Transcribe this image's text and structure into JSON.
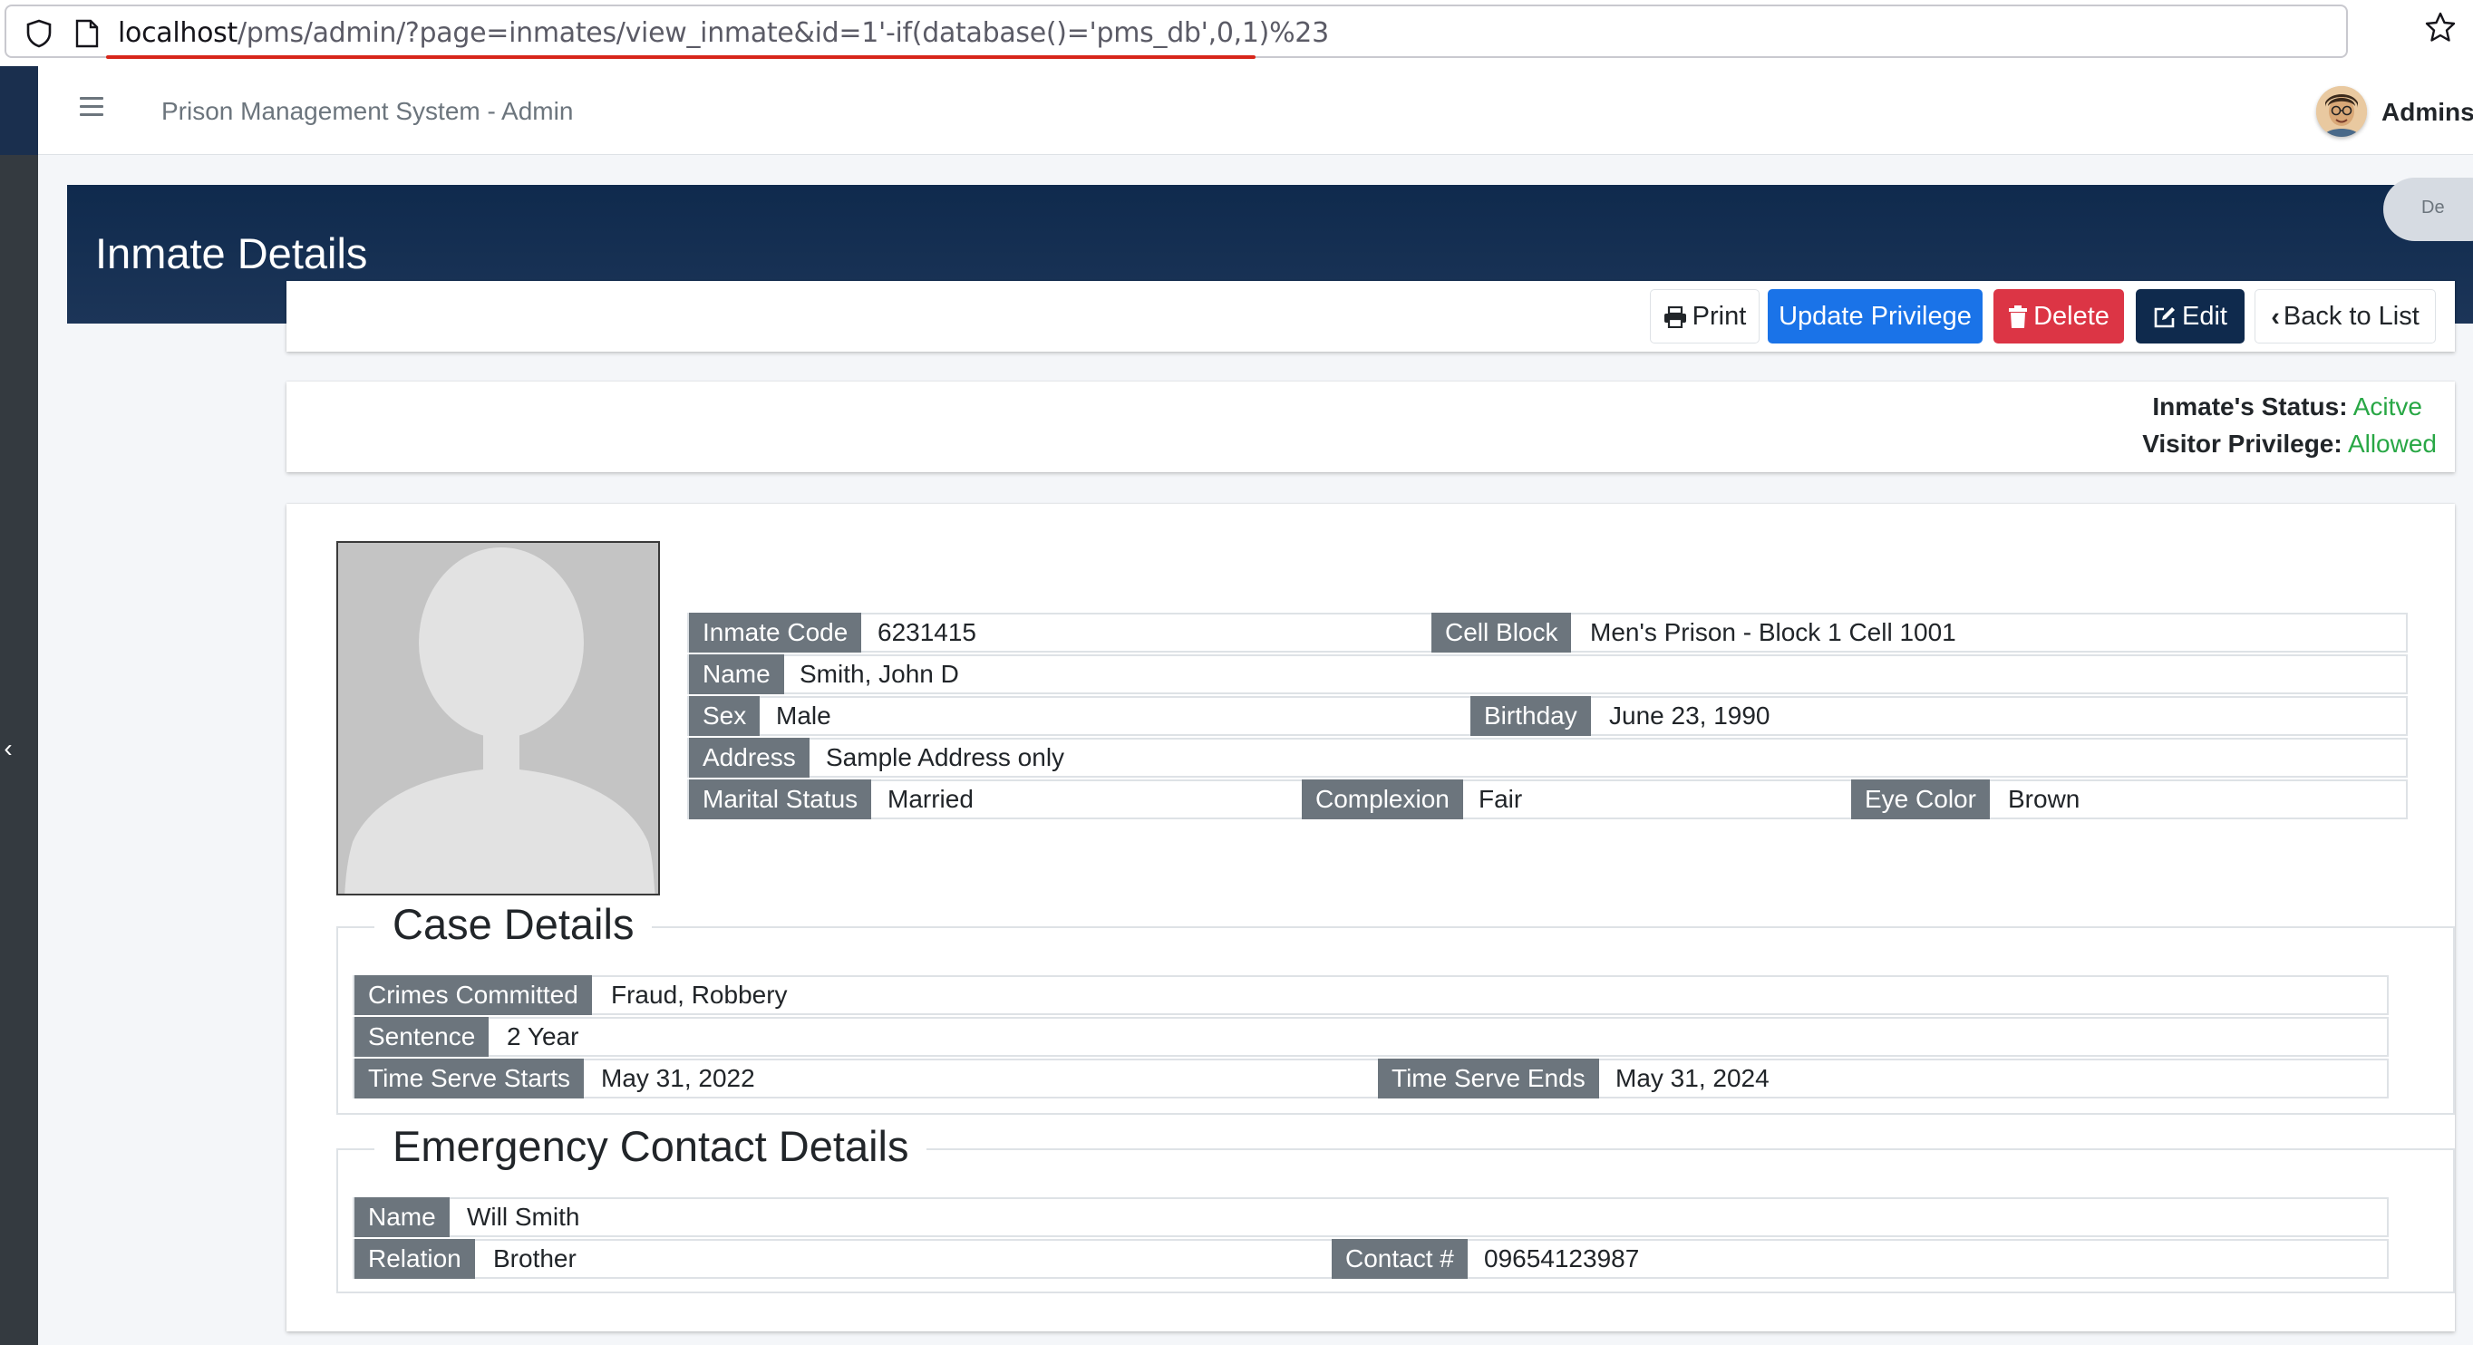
{
  "browser": {
    "url_host": "localhost",
    "url_path": "/pms/admin/?page=inmates/view_inmate&id=1'-if(database()='pms_db',0,1)%23"
  },
  "navbar": {
    "title": "Prison Management System - Admin",
    "user_name": "Admins"
  },
  "header": {
    "title": "Inmate Details",
    "dev_badge": "De"
  },
  "toolbar": {
    "print_label": "Print",
    "update_privilege_label": "Update Privilege",
    "delete_label": "Delete",
    "edit_label": "Edit",
    "back_label": "Back to List"
  },
  "status": {
    "inmate_status_label": "Inmate's Status:",
    "inmate_status_value": "Acitve",
    "visitor_privilege_label": "Visitor Privilege:",
    "visitor_privilege_value": "Allowed"
  },
  "inmate": {
    "code_label": "Inmate Code",
    "code": "6231415",
    "cell_block_label": "Cell Block",
    "cell_block": "Men's Prison - Block 1 Cell 1001",
    "name_label": "Name",
    "name": "Smith, John D",
    "sex_label": "Sex",
    "sex": "Male",
    "birthday_label": "Birthday",
    "birthday": "June 23, 1990",
    "address_label": "Address",
    "address": "Sample Address only",
    "marital_label": "Marital Status",
    "marital": "Married",
    "complexion_label": "Complexion",
    "complexion": "Fair",
    "eye_color_label": "Eye Color",
    "eye_color": "Brown"
  },
  "case": {
    "legend": "Case Details",
    "crimes_label": "Crimes Committed",
    "crimes": "Fraud, Robbery",
    "sentence_label": "Sentence",
    "sentence": "2 Year",
    "serve_start_label": "Time Serve Starts",
    "serve_start": "May 31, 2022",
    "serve_end_label": "Time Serve Ends",
    "serve_end": "May 31, 2024"
  },
  "emergency": {
    "legend": "Emergency Contact Details",
    "name_label": "Name",
    "name": "Will Smith",
    "relation_label": "Relation",
    "relation": "Brother",
    "contact_label": "Contact #",
    "contact": "09654123987"
  },
  "colors": {
    "header_navy": "#0f2a4d",
    "sidebar_dark": "#343a40",
    "primary_blue": "#1a73e8",
    "danger_red": "#dc3545",
    "success_green": "#28a745",
    "label_gray": "#6c757d"
  }
}
